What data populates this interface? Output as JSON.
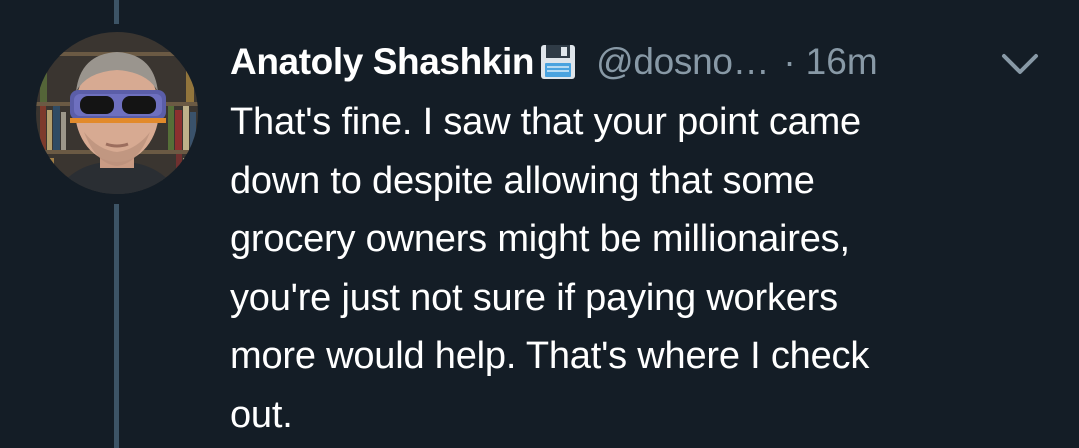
{
  "tweet": {
    "display_name": "Anatoly Shashkin",
    "badge_icon": "floppy-disk-icon",
    "handle": "@dosno…",
    "separator": "·",
    "timestamp": "16m",
    "menu_icon": "chevron-down-icon",
    "text": "That's fine. I saw that your point came\ndown to despite allowing that some\ngrocery owners might be millionaires,\nyou're just not sure if paying workers\nmore would help. That's where I check\nout."
  },
  "theme": {
    "background": "#141d26",
    "text": "#ffffff",
    "muted": "#8899a6",
    "thread_line": "#3d5466"
  }
}
